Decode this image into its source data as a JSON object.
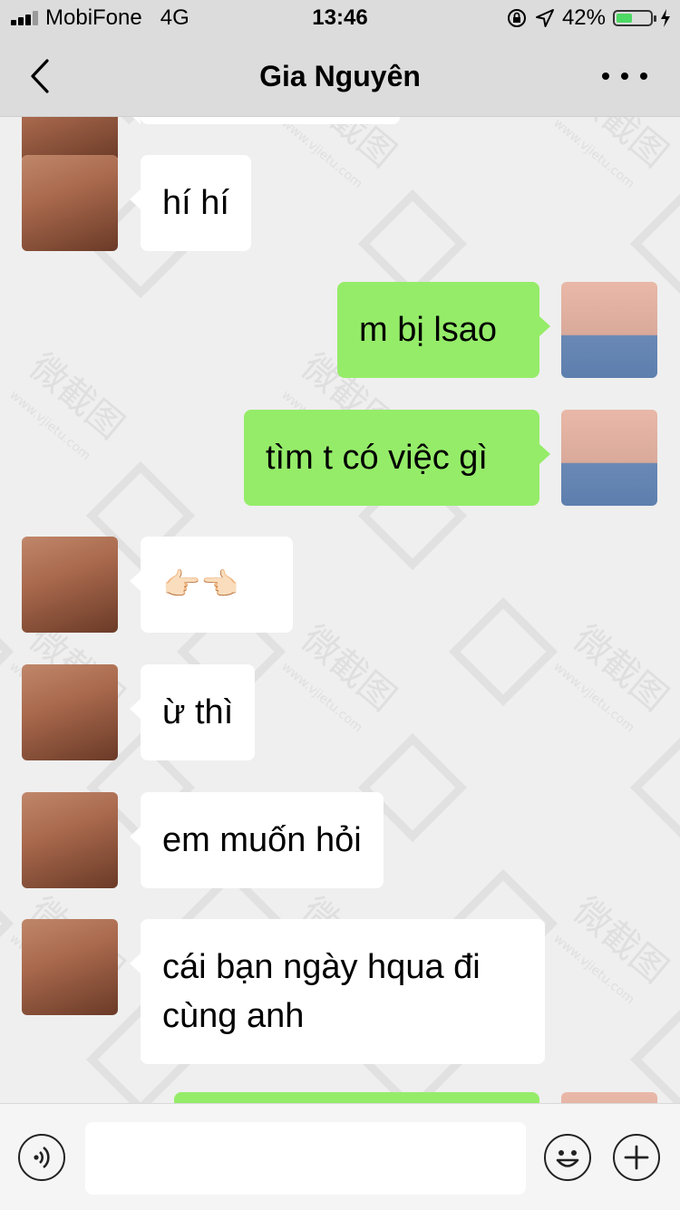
{
  "status_bar": {
    "carrier": "MobiFone",
    "network": "4G",
    "time": "13:46",
    "battery_percent": "42%",
    "battery_level": 0.42,
    "icons": [
      "signal-icon",
      "orientation-lock-icon",
      "location-icon",
      "battery-icon",
      "charging-icon"
    ]
  },
  "header": {
    "title": "Gia Nguyên",
    "back_icon": "chevron-left-icon",
    "more_icon": "more-dots-icon"
  },
  "messages": [
    {
      "side": "in",
      "text": "",
      "partial": true
    },
    {
      "side": "in",
      "text": "hí hí"
    },
    {
      "side": "out",
      "text": "m bị lsao"
    },
    {
      "side": "out",
      "text": "tìm t có việc gì"
    },
    {
      "side": "in",
      "text": "👉🏻👈🏻"
    },
    {
      "side": "in",
      "text": "ừ thì"
    },
    {
      "side": "in",
      "text": "em muốn hỏi"
    },
    {
      "side": "in",
      "text": "cái bạn ngày hqua đi cùng anh"
    },
    {
      "side": "out",
      "text": "",
      "partial": true
    }
  ],
  "watermark": {
    "text": "微截图",
    "url": "www.vjietu.com"
  },
  "input_bar": {
    "voice_icon": "voice-icon",
    "emoji_icon": "emoji-icon",
    "plus_icon": "plus-icon",
    "input_value": ""
  }
}
